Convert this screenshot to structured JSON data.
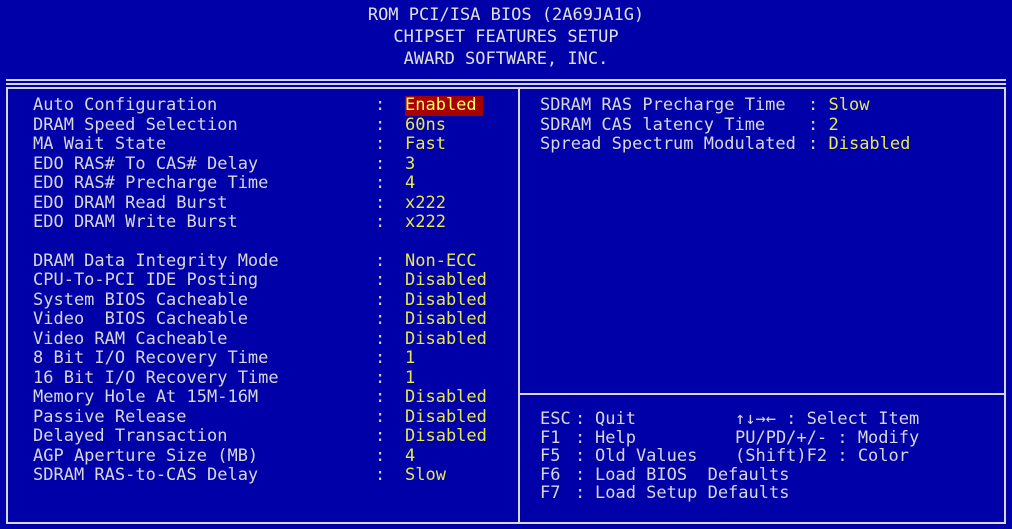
{
  "header": {
    "line1": "ROM PCI/ISA BIOS (2A69JA1G)",
    "line2": "CHIPSET FEATURES SETUP",
    "line3": "AWARD SOFTWARE, INC."
  },
  "colors": {
    "background": "#0000a8",
    "text": "#d8d8d8",
    "value": "#e8e850",
    "selected_bg": "#a80000"
  },
  "left_group1": [
    {
      "label": "Auto Configuration",
      "value": "Enabled",
      "selected": true
    },
    {
      "label": "DRAM Speed Selection",
      "value": "60ns"
    },
    {
      "label": "MA Wait State",
      "value": "Fast"
    },
    {
      "label": "EDO RAS# To CAS# Delay",
      "value": "3"
    },
    {
      "label": "EDO RAS# Precharge Time",
      "value": "4"
    },
    {
      "label": "EDO DRAM Read Burst",
      "value": "x222"
    },
    {
      "label": "EDO DRAM Write Burst",
      "value": "x222"
    }
  ],
  "left_group2": [
    {
      "label": "DRAM Data Integrity Mode",
      "value": "Non-ECC"
    },
    {
      "label": "CPU-To-PCI IDE Posting",
      "value": "Disabled"
    },
    {
      "label": "System BIOS Cacheable",
      "value": "Disabled"
    },
    {
      "label": "Video  BIOS Cacheable",
      "value": "Disabled"
    },
    {
      "label": "Video RAM Cacheable",
      "value": "Disabled"
    },
    {
      "label": "8 Bit I/O Recovery Time",
      "value": "1"
    },
    {
      "label": "16 Bit I/O Recovery Time",
      "value": "1"
    },
    {
      "label": "Memory Hole At 15M-16M",
      "value": "Disabled"
    },
    {
      "label": "Passive Release",
      "value": "Disabled"
    },
    {
      "label": "Delayed Transaction",
      "value": "Disabled"
    },
    {
      "label": "AGP Aperture Size (MB)",
      "value": "4"
    },
    {
      "label": "SDRAM RAS-to-CAS Delay",
      "value": "Slow"
    }
  ],
  "right_items": [
    {
      "label": "SDRAM RAS Precharge Time",
      "value": "Slow"
    },
    {
      "label": "SDRAM CAS latency Time",
      "value": "2"
    },
    {
      "label": "Spread Spectrum Modulated",
      "value": "Disabled"
    }
  ],
  "help": [
    {
      "key": "ESC",
      "desc": "Quit",
      "right": "↑↓→← : Select Item"
    },
    {
      "key": "F1",
      "desc": "Help",
      "right": "PU/PD/+/- : Modify"
    },
    {
      "key": "F5",
      "desc": "Old Values",
      "right": "(Shift)F2 : Color"
    },
    {
      "key": "F6",
      "desc": "Load BIOS  Defaults",
      "right": ""
    },
    {
      "key": "F7",
      "desc": "Load Setup Defaults",
      "right": ""
    }
  ]
}
